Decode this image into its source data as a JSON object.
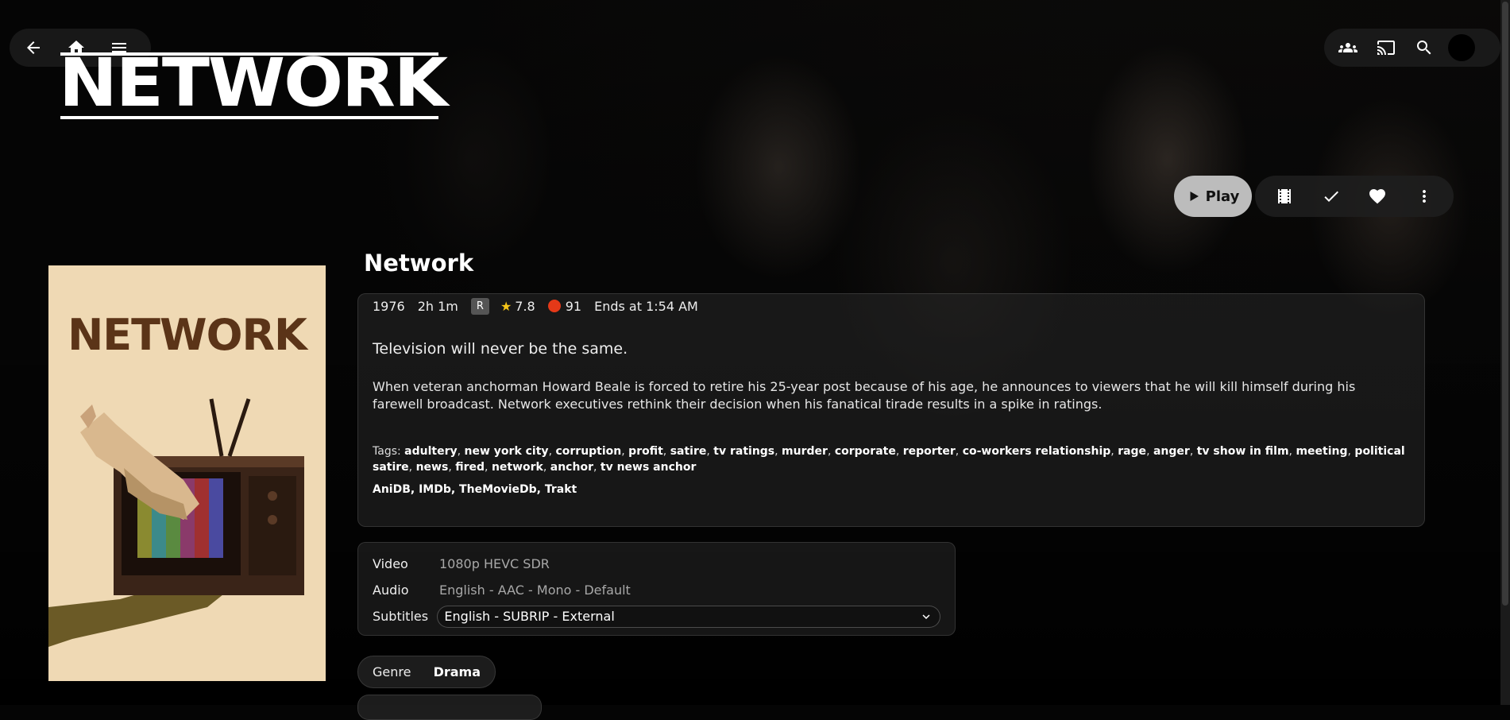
{
  "header": {
    "nav": {
      "back": "back-icon",
      "home": "home-icon",
      "menu": "menu-icon"
    },
    "right": {
      "sync_play": "group-icon",
      "cast": "cast-icon",
      "search": "search-icon"
    }
  },
  "logo_text": "NETWORK",
  "actions": {
    "play_label": "Play"
  },
  "poster": {
    "title": "NETWORK"
  },
  "movie": {
    "title": "Network",
    "year": "1976",
    "runtime": "2h 1m",
    "rating": "R",
    "community_rating": "7.8",
    "critic_rating": "91",
    "ends_at": "Ends at 1:54 AM",
    "tagline": "Television will never be the same.",
    "overview": "When veteran anchorman Howard Beale is forced to retire his 25-year post because of his age, he announces to viewers that he will kill himself during his farewell broadcast. Network executives rethink their decision when his fanatical tirade results in a spike in ratings.",
    "tags_label": "Tags:",
    "tags": [
      "adultery",
      "new york city",
      "corruption",
      "profit",
      "satire",
      "tv ratings",
      "murder",
      "corporate",
      "reporter",
      "co-workers relationship",
      "rage",
      "anger",
      "tv show in film",
      "meeting",
      "political satire",
      "news",
      "fired",
      "network",
      "anchor",
      "tv news anchor"
    ],
    "links": "AniDB, IMDb, TheMovieDb, Trakt"
  },
  "media": {
    "video_label": "Video",
    "video_value": "1080p HEVC SDR",
    "audio_label": "Audio",
    "audio_value": "English - AAC - Mono - Default",
    "subtitles_label": "Subtitles",
    "subtitles_value": "English - SUBRIP - External"
  },
  "genre": {
    "label": "Genre",
    "value": "Drama"
  },
  "colors": {
    "play_bg": "#bcbcbc",
    "star": "#f5c518",
    "tomato": "#e53918",
    "poster_bg": "#efd9b4",
    "poster_title": "#5b3418"
  }
}
